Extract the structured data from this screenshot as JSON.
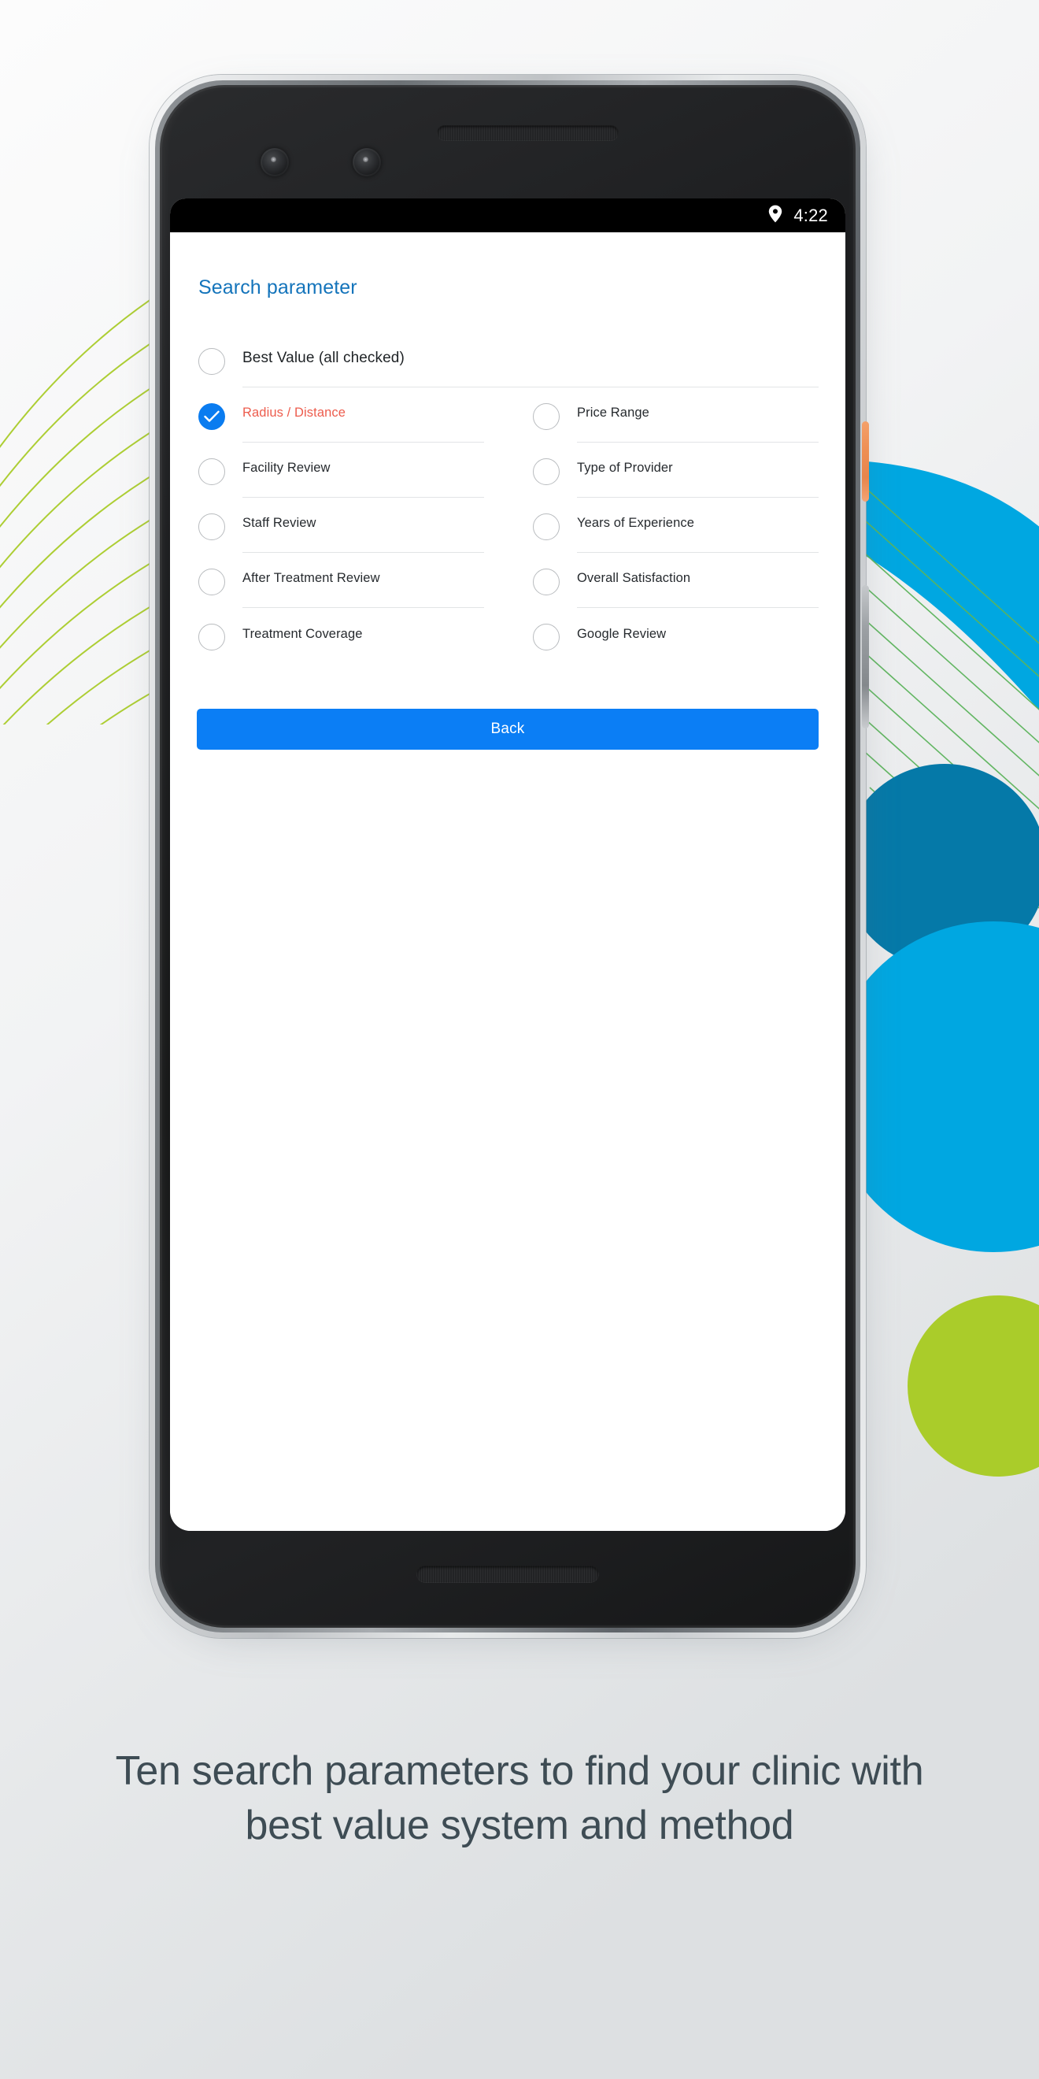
{
  "status_bar": {
    "time": "4:22",
    "location_icon": "location-pin-icon"
  },
  "screen": {
    "title": "Search parameter",
    "primary_option": {
      "label": "Best Value (all checked)",
      "checked": false
    },
    "options_left": [
      {
        "label": "Radius / Distance",
        "checked": true
      },
      {
        "label": "Facility Review",
        "checked": false
      },
      {
        "label": "Staff Review",
        "checked": false
      },
      {
        "label": "After Treatment Review",
        "checked": false
      },
      {
        "label": "Treatment Coverage",
        "checked": false
      }
    ],
    "options_right": [
      {
        "label": "Price Range",
        "checked": false
      },
      {
        "label": "Type of Provider",
        "checked": false
      },
      {
        "label": "Years of Experience",
        "checked": false
      },
      {
        "label": "Overall Satisfaction",
        "checked": false
      },
      {
        "label": "Google Review",
        "checked": false
      }
    ],
    "back_button": "Back"
  },
  "caption": "Ten search parameters to find your clinic with best value system and method",
  "colors": {
    "title_blue": "#1474bb",
    "button_blue": "#0b7ef5",
    "checked_blue": "#0a7cf0",
    "selected_red": "#ed5c4d",
    "deco_blue": "#00a7e1",
    "deco_blue_dark": "#0579a8",
    "deco_green": "#aacc2a",
    "caption_grey": "#3e4c54",
    "power_button_orange": "#ef8f54"
  }
}
